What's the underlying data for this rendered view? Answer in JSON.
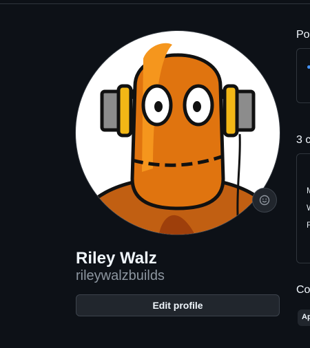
{
  "profile": {
    "display_name": "Riley Walz",
    "username": "rileywalzbuilds",
    "edit_profile_label": "Edit profile",
    "avatar_icon": "robot-headphones-avatar",
    "status_icon": "smiley-icon"
  },
  "right_column": {
    "popular_heading": "Po",
    "contrib_heading": "3 c",
    "contrib_lines": [
      "M",
      "W",
      "F"
    ],
    "section3_heading": "Co",
    "pill_label": "Ap"
  },
  "colors": {
    "background": "#0d1117",
    "border": "#30363d",
    "button_bg": "#21262d",
    "muted_text": "#8d96a0",
    "accent": "#4493f8"
  }
}
